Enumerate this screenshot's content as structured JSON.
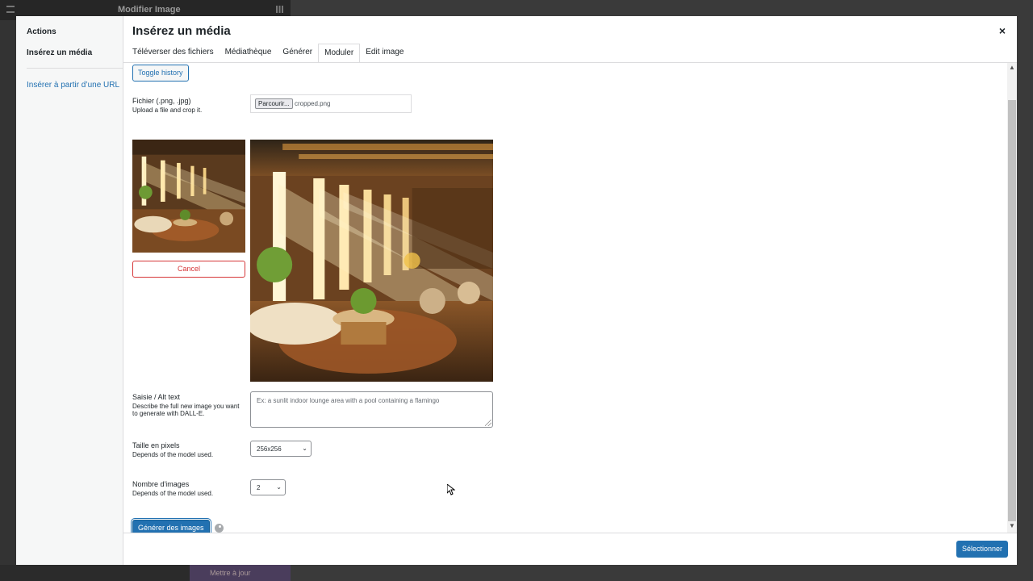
{
  "background": {
    "editor_title": "Modifier Image",
    "update_button": "Mettre à jour"
  },
  "modal": {
    "menu": {
      "heading": "Actions",
      "active_item": "Insérez un média",
      "url_link": "Insérer à partir d’une URL"
    },
    "title": "Insérez un média",
    "close_label": "×",
    "tabs": [
      {
        "label": "Téléverser des fichiers",
        "active": false
      },
      {
        "label": "Médiathèque",
        "active": false
      },
      {
        "label": "Générer",
        "active": false
      },
      {
        "label": "Moduler",
        "active": true
      },
      {
        "label": "Edit image",
        "active": false
      }
    ],
    "toggle_history": "Toggle history",
    "file": {
      "label": "Fichier (.png, .jpg)",
      "description": "Upload a file and crop it.",
      "browse_button": "Parcourir...",
      "file_name": "cropped.png"
    },
    "cancel_button": "Cancel",
    "alt_text": {
      "label": "Saisie / Alt text",
      "description": "Describe the full new image you want to generate with DALL-E.",
      "placeholder": "Ex: a sunlit indoor lounge area with a pool containing a flamingo"
    },
    "size": {
      "label": "Taille en pixels",
      "description": "Depends of the model used.",
      "selected": "256x256"
    },
    "count": {
      "label": "Nombre d'images",
      "description": "Depends of the model used.",
      "selected": "2"
    },
    "generate_button": "Générer des images",
    "select_button": "Sélectionner"
  }
}
